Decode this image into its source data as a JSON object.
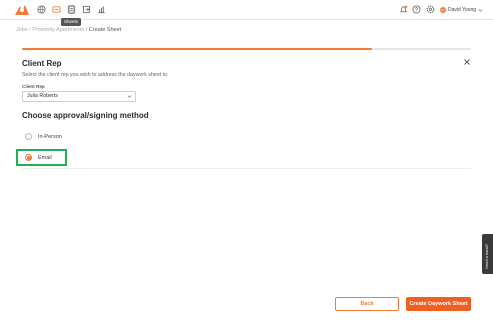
{
  "topbar": {
    "tooltip": "Sheets",
    "user_initials": "DY",
    "user_name": "David Young"
  },
  "breadcrumb": {
    "jobs": "Jobs",
    "sep1": " / ",
    "project": "Proximity Apartments",
    "sep2": " / ",
    "current": "Create Sheet"
  },
  "progress": {
    "fraction": 0.78
  },
  "client_rep": {
    "title": "Client Rep",
    "subtitle": "Select the client rep you wish to address the daywork sheet to.",
    "field_label": "Client Rep",
    "selected": "Julia Roberts"
  },
  "method": {
    "title": "Choose approval/signing method",
    "options": [
      {
        "label": "In-Person",
        "checked": false
      },
      {
        "label": "Email",
        "checked": true
      }
    ]
  },
  "actions": {
    "back": "Back",
    "create": "Create Daywork Sheet"
  },
  "side_tab": {
    "label": "Need a hand?"
  },
  "colors": {
    "accent": "#f47a3a",
    "highlight": "#1eb154"
  }
}
